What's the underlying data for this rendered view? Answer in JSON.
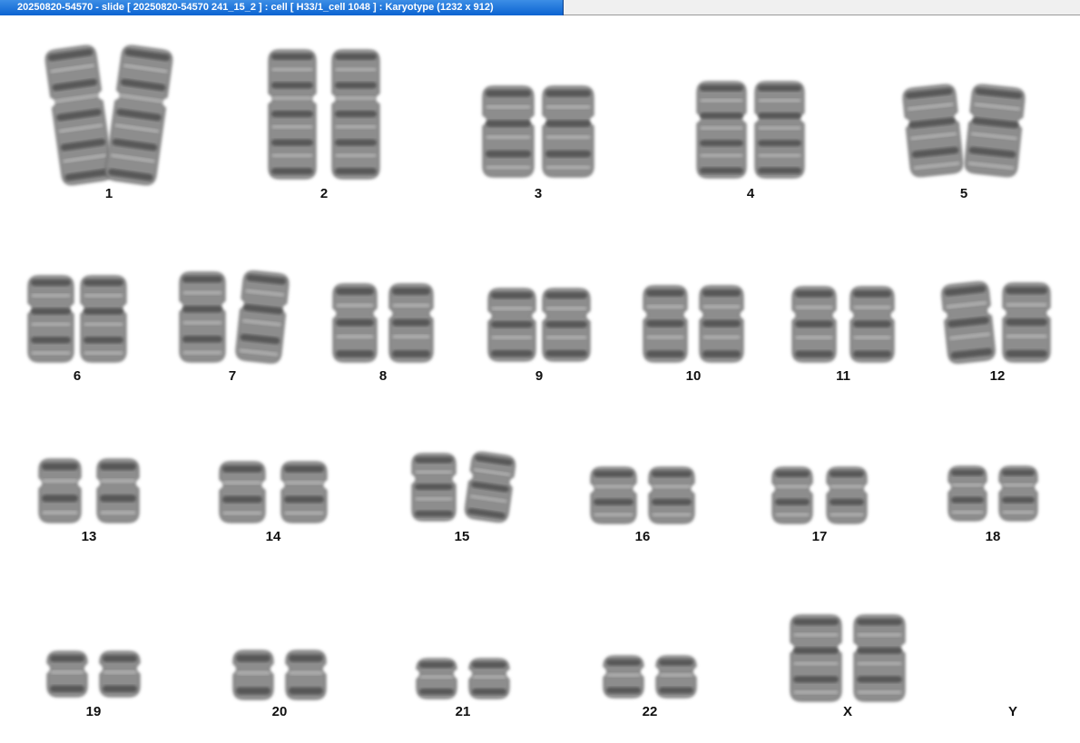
{
  "window": {
    "title": "20250820-54570 - slide [ 20250820-54570 241_15_2 ] : cell [ H33/1_cell 1048 ] : Karyotype  (1232 x 912)"
  },
  "karyotype": {
    "chromosomes": [
      {
        "id": "1",
        "label": "1"
      },
      {
        "id": "2",
        "label": "2"
      },
      {
        "id": "3",
        "label": "3"
      },
      {
        "id": "4",
        "label": "4"
      },
      {
        "id": "5",
        "label": "5"
      },
      {
        "id": "6",
        "label": "6"
      },
      {
        "id": "7",
        "label": "7"
      },
      {
        "id": "8",
        "label": "8"
      },
      {
        "id": "9",
        "label": "9"
      },
      {
        "id": "10",
        "label": "10"
      },
      {
        "id": "11",
        "label": "11"
      },
      {
        "id": "12",
        "label": "12"
      },
      {
        "id": "13",
        "label": "13"
      },
      {
        "id": "14",
        "label": "14"
      },
      {
        "id": "15",
        "label": "15"
      },
      {
        "id": "16",
        "label": "16"
      },
      {
        "id": "17",
        "label": "17"
      },
      {
        "id": "18",
        "label": "18"
      },
      {
        "id": "19",
        "label": "19"
      },
      {
        "id": "20",
        "label": "20"
      },
      {
        "id": "21",
        "label": "21"
      },
      {
        "id": "22",
        "label": "22"
      },
      {
        "id": "X",
        "label": "X"
      },
      {
        "id": "Y",
        "label": "Y"
      }
    ]
  }
}
